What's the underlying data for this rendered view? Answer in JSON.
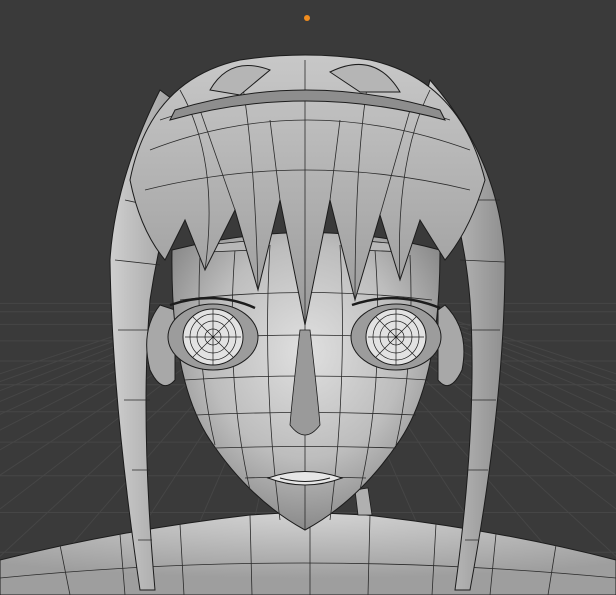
{
  "app": {
    "editor": "3D Viewport",
    "shading_mode": "solid",
    "overlay": "wireframe"
  },
  "colors": {
    "background": "#3a3a3a",
    "grid_line": "#464646",
    "mesh_light": "#d8d8d8",
    "mesh_mid": "#a8a8a8",
    "mesh_dark": "#6e6e6e",
    "wire": "#1c1c1c",
    "origin_dot": "#f08c1e"
  },
  "scene": {
    "object_type": "character head mesh",
    "origin_marker": "object-origin"
  }
}
